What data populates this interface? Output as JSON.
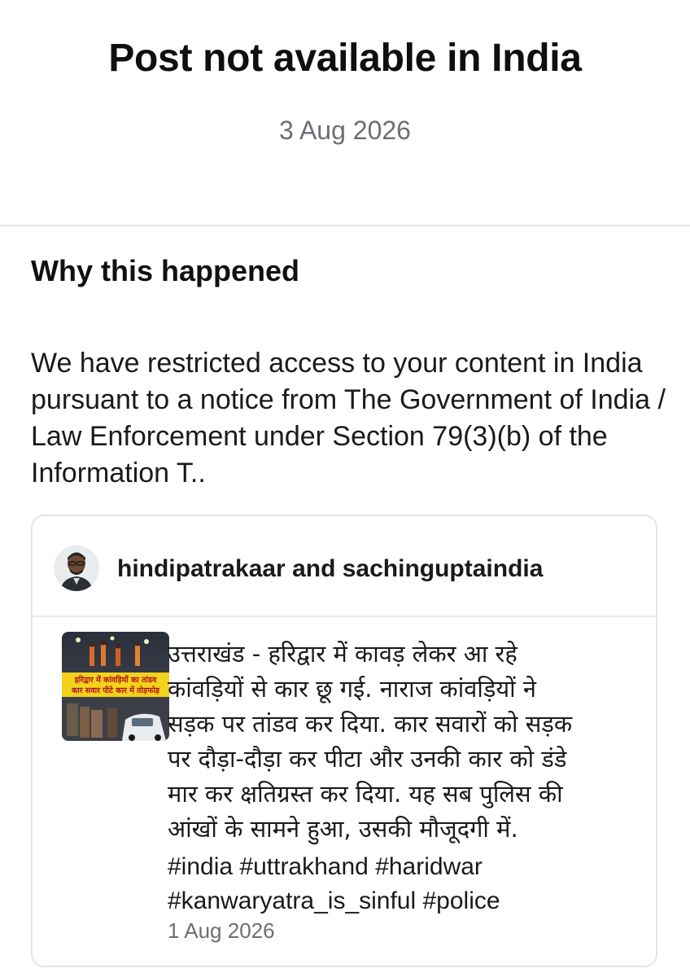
{
  "header": {
    "title": "Post not available in India",
    "date": "3 Aug 2026"
  },
  "reason": {
    "heading": "Why this happened",
    "text": "We have restricted access to your content in India pursuant to a notice from The Government of India / Law Enforcement under Section 79(3)(b) of the Information T.."
  },
  "post": {
    "authors": "hindipatrakaar and sachinguptaindia",
    "thumbnail": {
      "caption_line1": "हरिद्वार में कांवड़ियों का तांडव",
      "caption_line2": "कार सवार पीटे कार में तोड़फोड़"
    },
    "body_lines": [
      "उत्तराखंड - हरिद्वार में कावड़ लेकर आ रहे",
      "कांवड़ियों से कार छू गई. नाराज कांवड़ियों ने",
      "सड़क पर तांडव कर दिया. कार सवारों को सड़क"
    ],
    "body_lines_lower": [
      "पर दौड़ा-दौड़ा कर पीटा और उनकी कार को डंडे",
      "मार कर क्षतिग्रस्त कर दिया. यह सब पुलिस की",
      "आंखों के सामने हुआ, उसकी मौजूदगी में."
    ],
    "hashtags_line1": "#india #uttrakhand #haridwar",
    "hashtags_line2": "#kanwaryatra_is_sinful #police",
    "date": "1 Aug 2026"
  }
}
